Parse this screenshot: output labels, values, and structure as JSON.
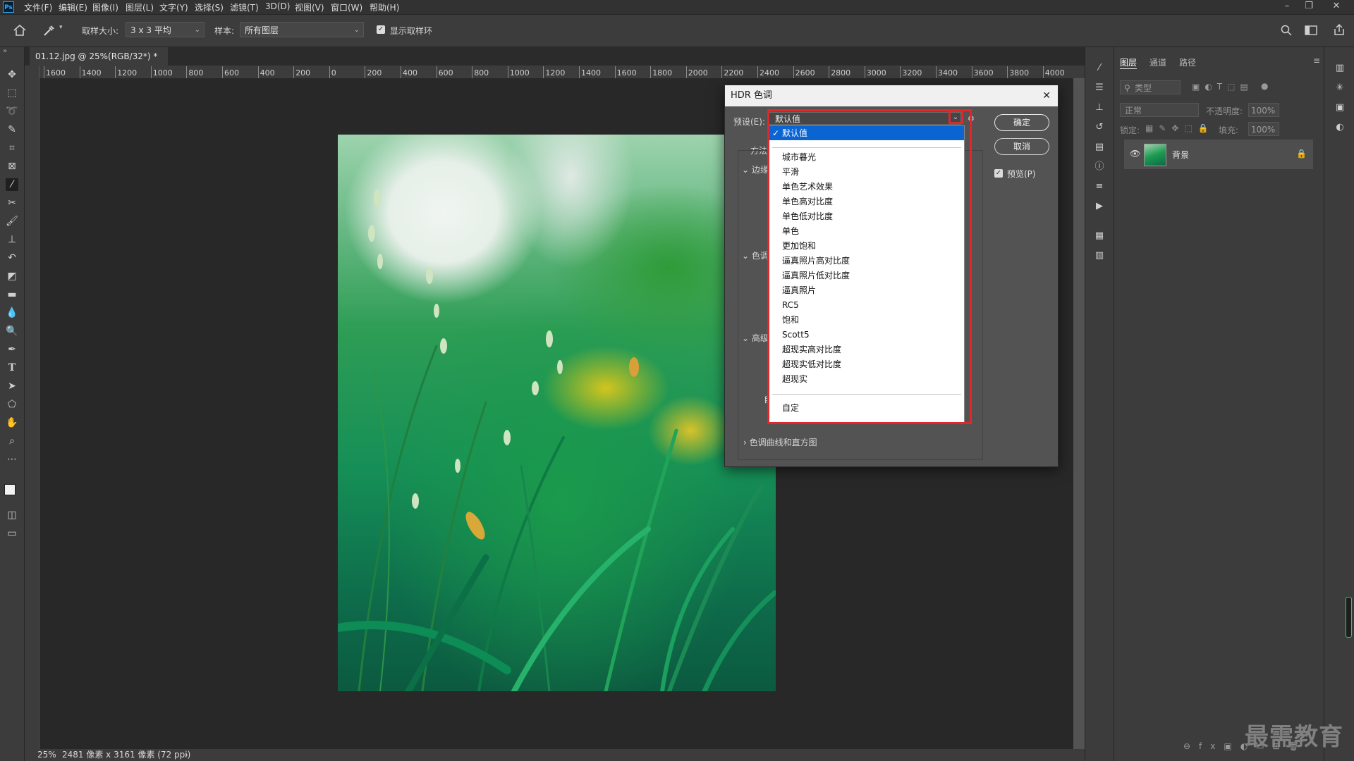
{
  "app": {
    "logo": "Ps"
  },
  "menubar": {
    "items": [
      "文件(F)",
      "编辑(E)",
      "图像(I)",
      "图层(L)",
      "文字(Y)",
      "选择(S)",
      "滤镜(T)",
      "3D(D)",
      "视图(V)",
      "窗口(W)",
      "帮助(H)"
    ],
    "window_controls": [
      "–",
      "❐",
      "✕"
    ]
  },
  "options": {
    "sample_size_label": "取样大小:",
    "sample_size_value": "3 x 3 平均",
    "sample_label": "样本:",
    "sample_value": "所有图层",
    "show_ring_label": "显示取样环",
    "show_ring_checked": true
  },
  "document": {
    "tab_title": "01.12.jpg @ 25%(RGB/32*) *",
    "tab_close": "×",
    "ruler_h": [
      "1600",
      "1400",
      "1200",
      "1000",
      "800",
      "600",
      "400",
      "200",
      "0",
      "200",
      "400",
      "600",
      "800",
      "1000",
      "1200",
      "1400",
      "1600",
      "1800",
      "2000",
      "2200",
      "2400",
      "2600",
      "2800",
      "3000",
      "3200",
      "3400",
      "3600",
      "3800",
      "4000"
    ]
  },
  "status": {
    "zoom": "25%",
    "doc_info": "2481 像素 x 3161 像素 (72 ppi)",
    "arrow": "›"
  },
  "layers_panel": {
    "tabs": [
      "图层",
      "通道",
      "路径"
    ],
    "filter_placeholder": "类型",
    "blend_mode": "正常",
    "opacity_label": "不透明度:",
    "opacity_value": "100%",
    "lock_label": "锁定:",
    "fill_label": "填充:",
    "fill_value": "100%",
    "layer_name": "背景"
  },
  "dialog": {
    "title": "HDR 色调",
    "close": "✕",
    "preset_label": "预设(E):",
    "preset_value": "默认值",
    "method_label": "方法",
    "section_edge": "边缘",
    "section_tone": "色调",
    "section_advanced": "高级",
    "auto_label": "自",
    "section_curve": "色调曲线和直方图",
    "ok_label": "确定",
    "cancel_label": "取消",
    "preview_label": "预览(P)",
    "preview_checked": true,
    "dropdown": {
      "selected": "默认值",
      "items": [
        "城市暮光",
        "平滑",
        "单色艺术效果",
        "单色高对比度",
        "单色低对比度",
        "单色",
        "更加饱和",
        "逼真照片高对比度",
        "逼真照片低对比度",
        "逼真照片",
        "RC5",
        "饱和",
        "Scott5",
        "超现实高对比度",
        "超现实低对比度",
        "超现实"
      ],
      "custom": "自定"
    }
  },
  "watermark": "最需教育",
  "colors": {
    "accent_red": "#e0272c",
    "selection_blue": "#0a64d2",
    "ps_blue": "#31a8ff"
  }
}
